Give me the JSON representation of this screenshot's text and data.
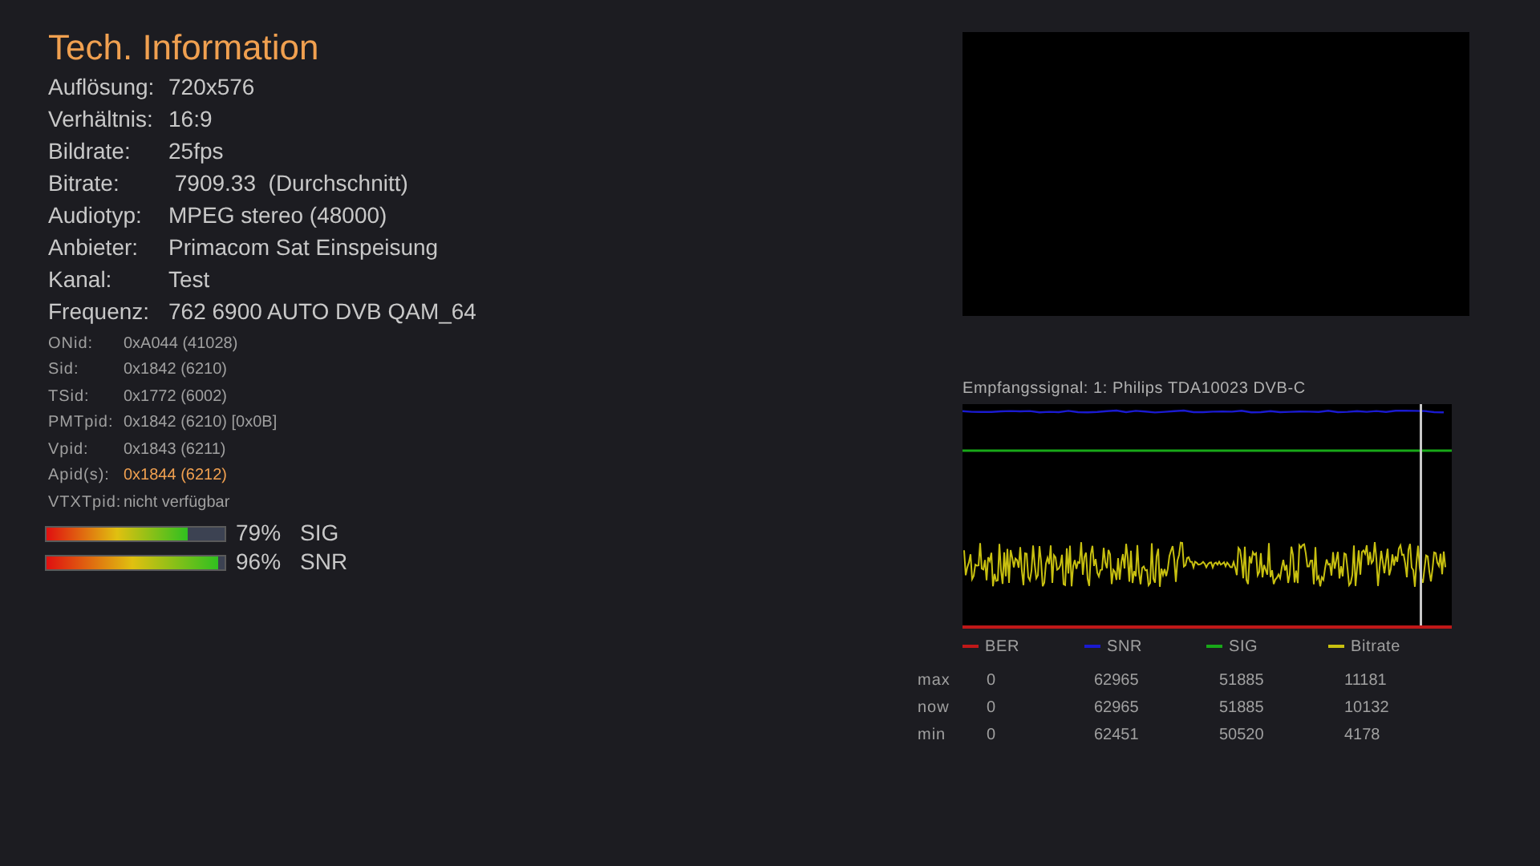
{
  "title": "Tech. Information",
  "info": [
    {
      "label": "Auflösung:",
      "value": "720x576"
    },
    {
      "label": "Verhältnis:",
      "value": "16:9"
    },
    {
      "label": "Bildrate:",
      "value": "25fps"
    },
    {
      "label": "Bitrate:",
      "value": " 7909.33  (Durchschnitt)"
    },
    {
      "label": "Audiotyp:",
      "value": "MPEG stereo (48000)"
    },
    {
      "label": "Anbieter:",
      "value": "Primacom Sat Einspeisung"
    },
    {
      "label": "Kanal:",
      "value": "Test"
    },
    {
      "label": "Frequenz:",
      "value": "762 6900 AUTO DVB QAM_64"
    }
  ],
  "pids": [
    {
      "label": "ONid:",
      "value": "0xA044 (41028)",
      "highlight": false
    },
    {
      "label": "Sid:",
      "value": "0x1842 (6210)",
      "highlight": false
    },
    {
      "label": "TSid:",
      "value": "0x1772 (6002)",
      "highlight": false
    },
    {
      "label": "PMTpid:",
      "value": "0x1842 (6210) [0x0B]",
      "highlight": false
    },
    {
      "label": "Vpid:",
      "value": "0x1843 (6211)",
      "highlight": false
    },
    {
      "label": "Apid(s):",
      "value": "0x1844 (6212)",
      "highlight": true
    },
    {
      "label": "VTXTpid:",
      "value": "nicht verfügbar",
      "highlight": false
    }
  ],
  "meters": [
    {
      "level": 0.79,
      "percent": "79%",
      "label": "SIG"
    },
    {
      "level": 0.96,
      "percent": "96%",
      "label": "SNR"
    }
  ],
  "graph": {
    "title": "Empfangssignal: 1: Philips TDA10023 DVB-C",
    "legend": [
      {
        "label": "BER",
        "color": "#c01818"
      },
      {
        "label": "SNR",
        "color": "#1a1ad0"
      },
      {
        "label": "SIG",
        "color": "#18a818"
      },
      {
        "label": "Bitrate",
        "color": "#c8c010"
      }
    ],
    "stats": [
      {
        "label": "max",
        "values": [
          "0",
          "62965",
          "51885",
          "11181"
        ]
      },
      {
        "label": "now",
        "values": [
          "0",
          "62965",
          "51885",
          "10132"
        ]
      },
      {
        "label": "min",
        "values": [
          "0",
          "62451",
          "50520",
          "4178"
        ]
      }
    ]
  }
}
